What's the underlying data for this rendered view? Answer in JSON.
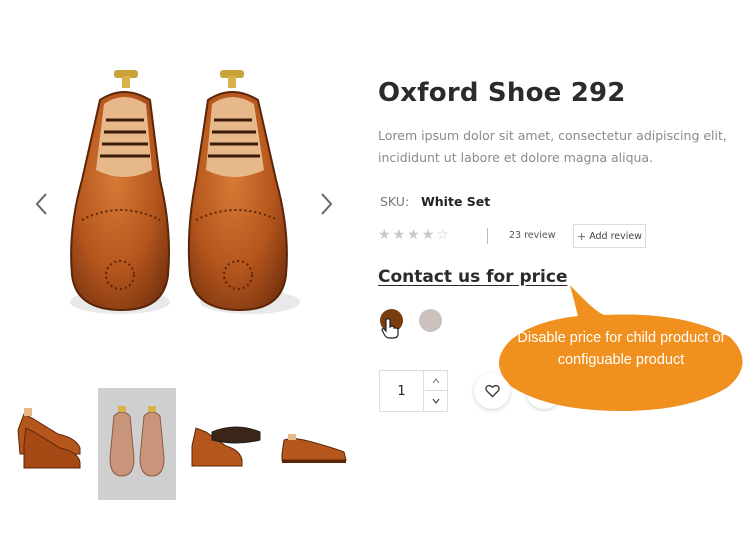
{
  "product": {
    "title": "Oxford Shoe 292",
    "description": "Lorem ipsum dolor sit amet, consectetur adipiscing elit, incididunt ut labore et dolore magna aliqua.",
    "sku_label": "SKU:",
    "sku_value": "White Set",
    "rating": {
      "filled": 4,
      "total": 5,
      "star_glyph": "★",
      "empty_glyph": "☆"
    },
    "review_count": "23 review",
    "add_review_label": "Add review",
    "add_review_icon": "plus-icon",
    "price_text": "Contact us for price",
    "swatches": [
      {
        "name": "brown",
        "color": "#7a3d10"
      },
      {
        "name": "grey",
        "color": "#cbc1bd"
      }
    ],
    "quantity": "1"
  },
  "gallery": {
    "prev_icon": "chevron-left-icon",
    "next_icon": "chevron-right-icon",
    "thumbnails": [
      {
        "name": "pair-side-view",
        "active": false
      },
      {
        "name": "pair-top-view-light",
        "active": true
      },
      {
        "name": "pair-sole-view",
        "active": false
      },
      {
        "name": "single-side-view",
        "active": false
      }
    ]
  },
  "actions": {
    "wishlist_icon": "heart-icon",
    "compare_icon": "compare-icon"
  },
  "callout": {
    "text": "Disable price for child product of configuable product",
    "color": "#f0901e"
  },
  "colors": {
    "leather": "#b5561d",
    "leather_dark": "#7a3410",
    "text_muted": "#8a8a8a"
  }
}
